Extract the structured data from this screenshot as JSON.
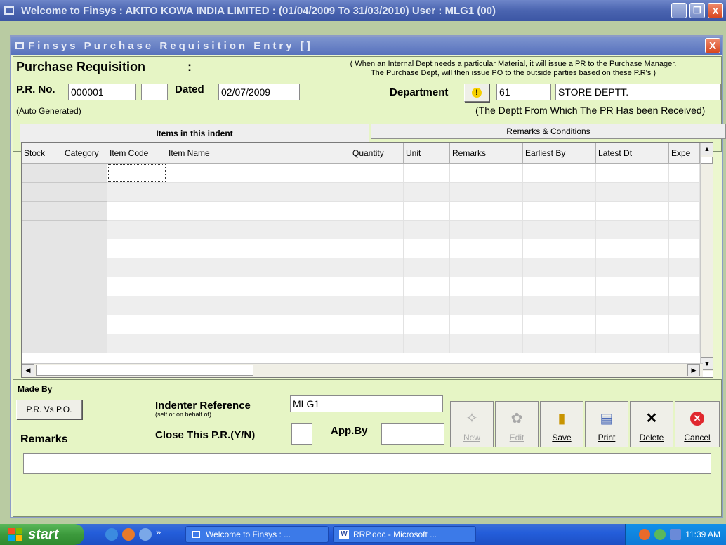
{
  "window": {
    "title": "Welcome to Finsys : AKITO KOWA INDIA LIMITED : (01/04/2009 To 31/03/2010) User : MLG1 (00)",
    "minimize": "_",
    "restore": "❐",
    "close": "X"
  },
  "form": {
    "title": "Finsys Purchase Requisition Entry []",
    "close": "X"
  },
  "header": {
    "heading": "Purchase Requisition",
    "colon": ":",
    "info_line1": "( When an Internal Dept needs a particular Material, it will issue a PR to the Purchase Manager.",
    "info_line2": "The Purchase Dept, will then issue PO to the outside parties based on these P.R's )",
    "pr_no_label": "P.R. No.",
    "pr_no_value": "000001",
    "pr_no_suffix": "",
    "auto_generated": "(Auto Generated)",
    "dated_label": "Dated",
    "dated_value": "02/07/2009",
    "department_label": "Department",
    "department_code": "61",
    "department_name": "STORE DEPTT.",
    "department_note": "(The Deptt From Which The PR Has been Received)"
  },
  "tabs": {
    "items": "Items in this indent",
    "remarks": "Remarks & Conditions"
  },
  "grid": {
    "columns": [
      "Stock",
      "Category",
      "Item Code",
      "Item Name",
      "Quantity",
      "Unit",
      "Remarks",
      "Earliest By",
      "Latest Dt",
      "Expe"
    ],
    "row_count": 10
  },
  "bottom": {
    "made_by": "Made By",
    "pr_vs_po": "P.R. Vs P.O.",
    "indenter_label": "Indenter Reference",
    "indenter_sub": "(self or on behalf of)",
    "indenter_value": "MLG1",
    "close_label": "Close This P.R.(Y/N)",
    "close_value": "",
    "app_by_label": "App.By",
    "app_by_value": "",
    "remarks_label": "Remarks",
    "remarks_value": ""
  },
  "toolbar": {
    "new": "New",
    "edit": "Edit",
    "save": "Save",
    "print": "Print",
    "delete": "Delete",
    "cancel": "Cancel"
  },
  "taskbar": {
    "start": "start",
    "more": "»",
    "task1": "Welcome to Finsys : ...",
    "task2": "RRP.doc - Microsoft ...",
    "clock": "11:39 AM"
  },
  "colors": {
    "form_bg": "#ecf7cf",
    "title_blue": "#5872bd",
    "close_red": "#d8471f"
  }
}
